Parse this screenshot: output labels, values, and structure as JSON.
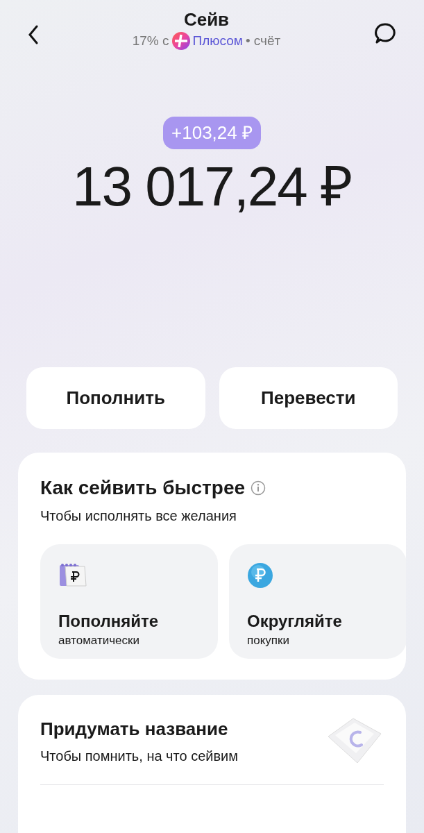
{
  "header": {
    "title": "Сейв",
    "subtitle_prefix": "17% с",
    "plus_label": "Плюсом",
    "subtitle_suffix": "• счёт"
  },
  "balance": {
    "change": "+103,24 ₽",
    "amount": "13 017,24 ₽"
  },
  "actions": [
    "Пополнить",
    "Перевести"
  ],
  "tips": {
    "title": "Как сейвить быстрее",
    "subtitle": "Чтобы исполнять все желания",
    "cards": [
      {
        "kind": "calendar",
        "title": "Пополняйте",
        "subtitle": "автоматически"
      },
      {
        "kind": "coin",
        "title": "Округляйте",
        "subtitle": "покупки"
      }
    ]
  },
  "name_card": {
    "title": "Придумать название",
    "subtitle": "Чтобы помнить, на что сейвим"
  }
}
